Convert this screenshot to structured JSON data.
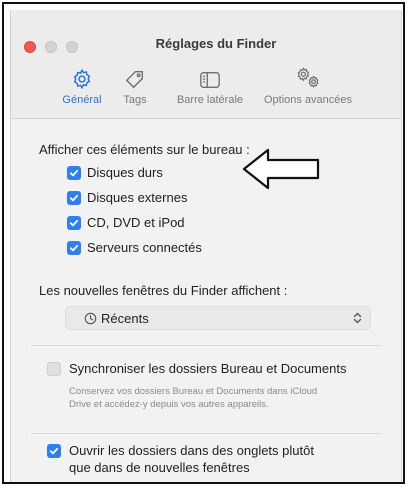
{
  "window": {
    "title": "Réglages du Finder"
  },
  "tabs": [
    {
      "label": "Général",
      "icon": "gear-icon",
      "active": true
    },
    {
      "label": "Tags",
      "icon": "tag-icon",
      "active": false
    },
    {
      "label": "Barre latérale",
      "icon": "sidebar-icon",
      "active": false
    },
    {
      "label": "Options avancées",
      "icon": "gears-icon",
      "active": false
    }
  ],
  "desktop": {
    "heading": "Afficher ces éléments sur le bureau :",
    "items": [
      {
        "label": "Disques durs",
        "checked": true
      },
      {
        "label": "Disques externes",
        "checked": true
      },
      {
        "label": "CD, DVD et iPod",
        "checked": true
      },
      {
        "label": "Serveurs connectés",
        "checked": true
      }
    ]
  },
  "new_windows": {
    "heading": "Les nouvelles fenêtres du Finder affichent :",
    "selected": "Récents"
  },
  "sync": {
    "label": "Synchroniser les dossiers Bureau et Documents",
    "checked": false,
    "help": "Conservez vos dossiers Bureau et Documents dans iCloud Drive et accédez-y depuis vos autres appareils."
  },
  "tabs_option": {
    "label_line1": "Ouvrir les dossiers dans des onglets plutôt",
    "label_line2": "que dans de nouvelles fenêtres",
    "checked": true
  },
  "colors": {
    "accent": "#2f7ff0",
    "active_tab": "#2a72d8",
    "close_light": "#ee5a55"
  }
}
